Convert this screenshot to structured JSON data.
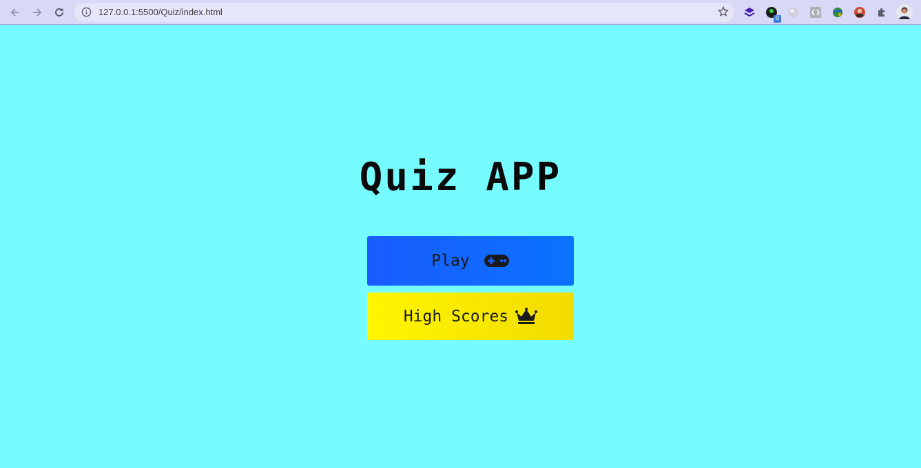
{
  "browser": {
    "url": "127.0.0.1:5500/Quiz/index.html",
    "extension_badge": "0"
  },
  "page": {
    "title": "Quiz APP",
    "play_label": "Play",
    "high_scores_label": "High Scores"
  },
  "colors": {
    "background": "#76fbff",
    "play_button": "#0a6bff",
    "high_scores_button": "#f8ec00"
  },
  "icons": {
    "play": "gamepad-icon",
    "high_scores": "crown-icon"
  }
}
